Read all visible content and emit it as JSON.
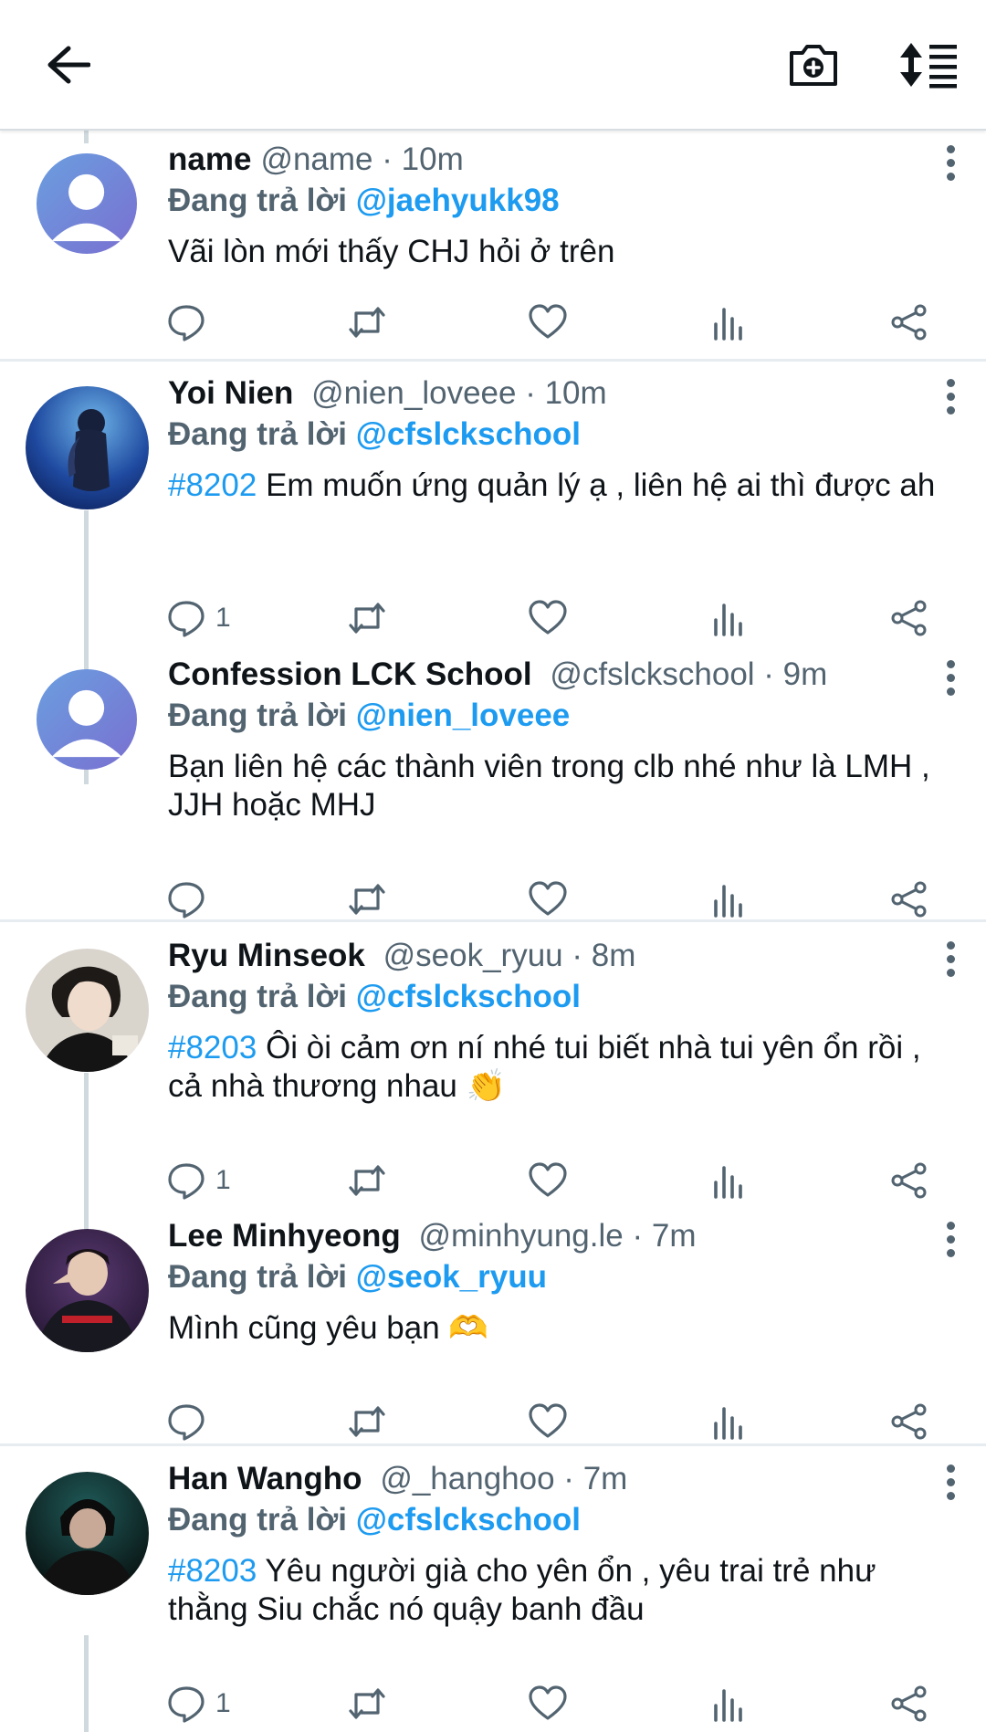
{
  "header": {
    "back_icon": "arrow-left-icon",
    "camera_icon": "camera-add-icon",
    "sort_icon": "sort-list-icon"
  },
  "colors": {
    "accent": "#1d9bf0",
    "secondary_text": "#536471",
    "primary_text": "#0f1419",
    "divider": "#e6ecf0"
  },
  "tweets": [
    {
      "name": "name",
      "handle": "@name",
      "time": "10m",
      "reply_prefix": "Đang trả lời",
      "reply_to": "@jaehyukk98",
      "tag": "",
      "text": "Vãi lòn mới thấy CHJ hỏi ở trên",
      "reply_count": ""
    },
    {
      "name": "Yoi Nien",
      "handle": "@nien_loveee",
      "time": "10m",
      "reply_prefix": "Đang trả lời",
      "reply_to": "@cfslckschool",
      "tag": "#8202",
      "text": "Em muốn ứng quản lý ạ , liên hệ ai thì được ah",
      "reply_count": "1"
    },
    {
      "name": "Confession LCK School",
      "handle": "@cfslckschool",
      "time": "9m",
      "reply_prefix": "Đang trả lời",
      "reply_to": "@nien_loveee",
      "tag": "",
      "text": "Bạn liên hệ các thành viên trong clb nhé như là LMH , JJH hoặc MHJ",
      "reply_count": ""
    },
    {
      "name": "Ryu Minseok",
      "handle": "@seok_ryuu",
      "time": "8m",
      "reply_prefix": "Đang trả lời",
      "reply_to": "@cfslckschool",
      "tag": "#8203",
      "text": "Ôi òi cảm ơn ní nhé tui biết nhà tui yên ổn rồi , cả nhà thương nhau 👏",
      "reply_count": "1"
    },
    {
      "name": "Lee Minhyeong",
      "handle": "@minhyung.le",
      "time": "7m",
      "reply_prefix": "Đang trả lời",
      "reply_to": "@seok_ryuu",
      "tag": "",
      "text": "Mình cũng yêu bạn 🫶",
      "reply_count": ""
    },
    {
      "name": "Han Wangho",
      "handle": "@_hanghoo",
      "time": "7m",
      "reply_prefix": "Đang trả lời",
      "reply_to": "@cfslckschool",
      "tag": "#8203",
      "text": "Yêu người già cho yên ổn , yêu trai trẻ như thằng Siu chắc nó quậy banh đầu",
      "reply_count": "1"
    }
  ]
}
